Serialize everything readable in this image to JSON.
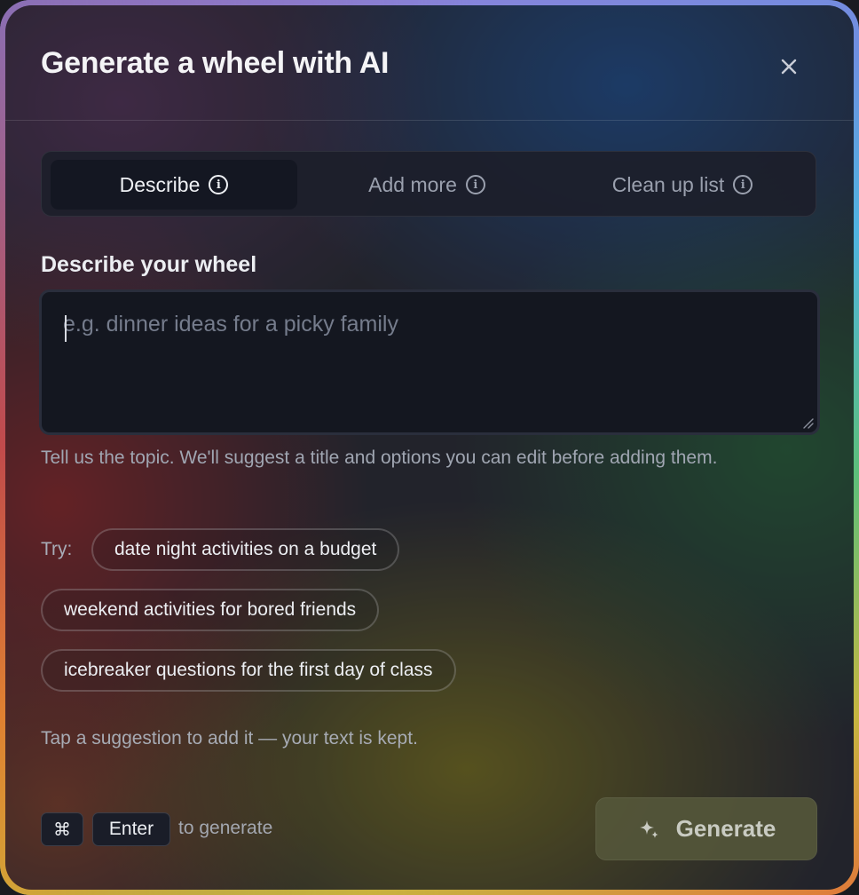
{
  "dialog": {
    "title": "Generate a wheel with AI",
    "close_icon": "close-icon"
  },
  "tabs": [
    {
      "label": "Describe",
      "icon": "info-icon",
      "active": true
    },
    {
      "label": "Add more",
      "icon": "info-icon",
      "active": false
    },
    {
      "label": "Clean up list",
      "icon": "info-icon",
      "active": false
    }
  ],
  "describe": {
    "label": "Describe your wheel",
    "value": "",
    "placeholder": "e.g. dinner ideas for a picky family",
    "hint": "Tell us the topic. We'll suggest a title and options you can edit before adding them."
  },
  "suggestions": {
    "try_label": "Try:",
    "items": [
      "date night activities on a budget",
      "weekend activities for bored friends",
      "icebreaker questions for the first day of class"
    ],
    "hint": "Tap a suggestion to add it — your text is kept."
  },
  "footer": {
    "shortcut_keys": [
      "⌘",
      "Enter"
    ],
    "shortcut_hint": "to generate",
    "generate_label": "Generate",
    "generate_icon": "sparkle-icon"
  },
  "colors": {
    "panel_dark": "#141720",
    "tab_active": "#141722",
    "generate_bg": "#54563a",
    "text_primary": "#eceef2",
    "text_muted": "#a0a6b2"
  }
}
